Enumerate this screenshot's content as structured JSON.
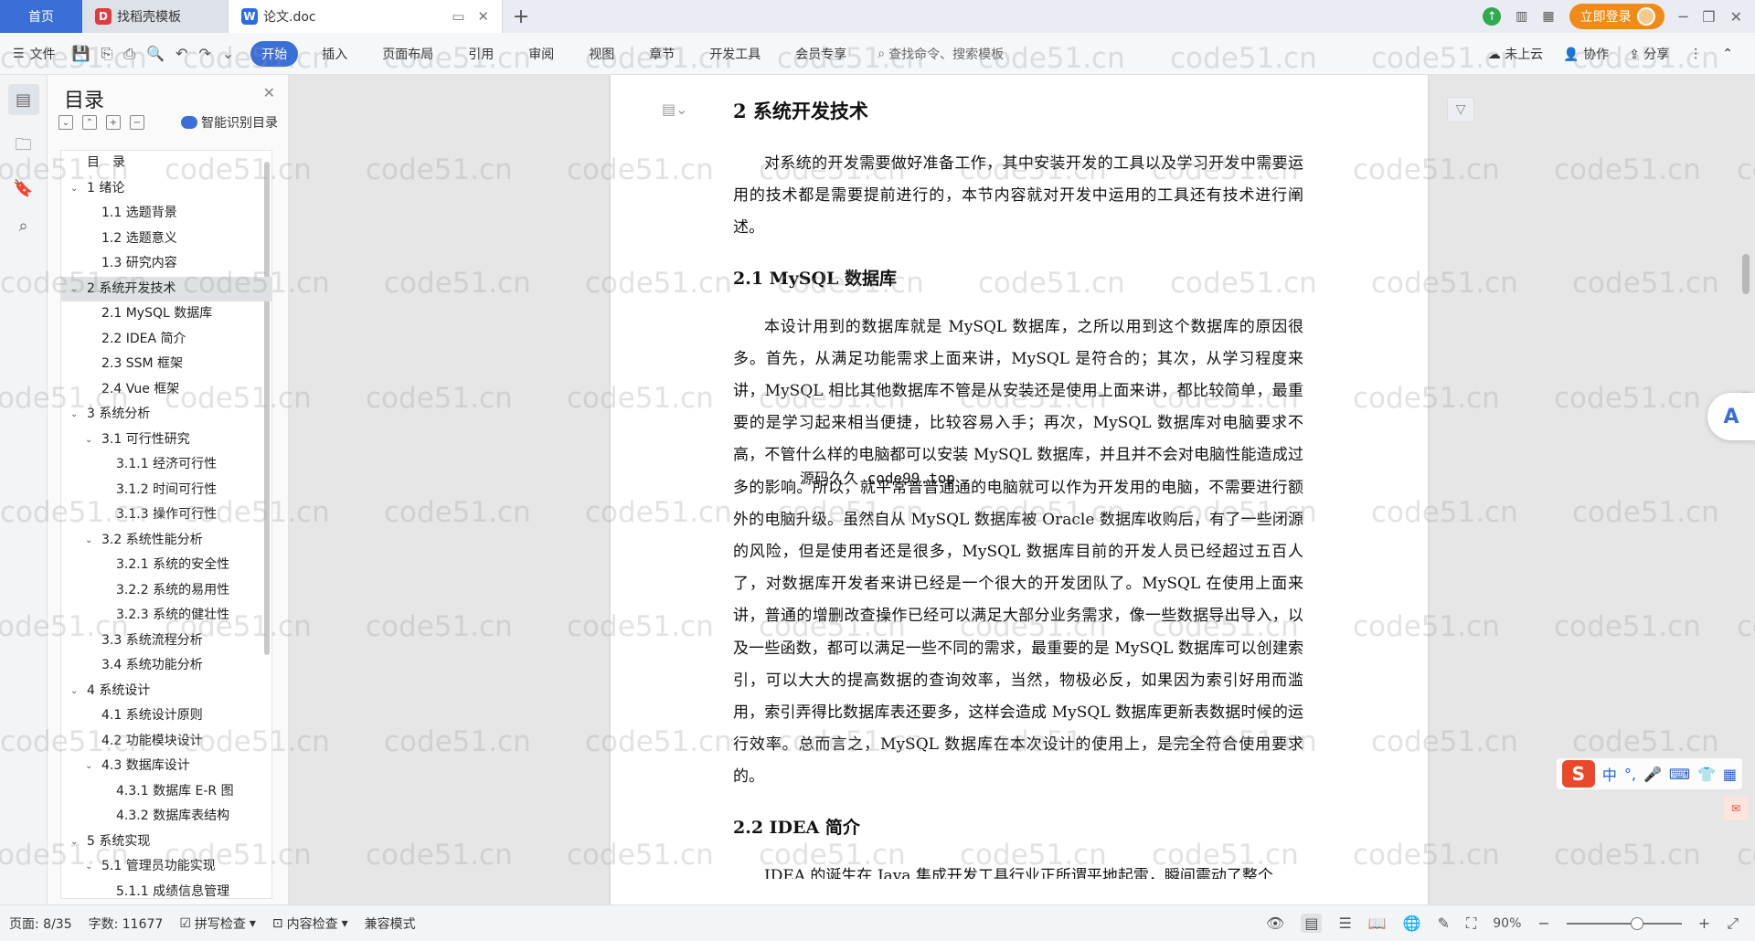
{
  "tabs": {
    "home": "首页",
    "template_tab": "找稻壳模板",
    "doc_tab": "论文.doc",
    "new_tab": "+"
  },
  "titlebar_right": {
    "login": "立即登录"
  },
  "ribbon": {
    "file": "文件",
    "tabs": [
      "开始",
      "插入",
      "页面布局",
      "引用",
      "审阅",
      "视图",
      "章节",
      "开发工具",
      "会员专享"
    ],
    "search": "查找命令、搜索模板",
    "cloud": "未上云",
    "collab": "协作",
    "share": "分享"
  },
  "toc": {
    "title": "目录",
    "smart": "智能识别目录",
    "items": [
      {
        "text": "目　录",
        "level": 1,
        "expand": ""
      },
      {
        "text": "1  绪论",
        "level": 1,
        "expand": "open"
      },
      {
        "text": "1.1  选题背景",
        "level": 2,
        "expand": ""
      },
      {
        "text": "1.2  选题意义",
        "level": 2,
        "expand": ""
      },
      {
        "text": "1.3  研究内容",
        "level": 2,
        "expand": ""
      },
      {
        "text": "2  系统开发技术",
        "level": 1,
        "expand": "open",
        "selected": true
      },
      {
        "text": "2.1 MySQL 数据库",
        "level": 2,
        "expand": ""
      },
      {
        "text": "2.2 IDEA 简介",
        "level": 2,
        "expand": ""
      },
      {
        "text": "2.3 SSM 框架",
        "level": 2,
        "expand": ""
      },
      {
        "text": "2.4 Vue 框架",
        "level": 2,
        "expand": ""
      },
      {
        "text": "3  系统分析",
        "level": 1,
        "expand": "open"
      },
      {
        "text": "3.1  可行性研究",
        "level": 2,
        "expand": "open"
      },
      {
        "text": "3.1.1  经济可行性",
        "level": 3,
        "expand": ""
      },
      {
        "text": "3.1.2  时间可行性",
        "level": 3,
        "expand": ""
      },
      {
        "text": "3.1.3  操作可行性",
        "level": 3,
        "expand": ""
      },
      {
        "text": "3.2  系统性能分析",
        "level": 2,
        "expand": "open"
      },
      {
        "text": "3.2.1  系统的安全性",
        "level": 3,
        "expand": ""
      },
      {
        "text": "3.2.2  系统的易用性",
        "level": 3,
        "expand": ""
      },
      {
        "text": "3.2.3  系统的健壮性",
        "level": 3,
        "expand": ""
      },
      {
        "text": "3.3  系统流程分析",
        "level": 2,
        "expand": ""
      },
      {
        "text": "3.4  系统功能分析",
        "level": 2,
        "expand": ""
      },
      {
        "text": "4  系统设计",
        "level": 1,
        "expand": "open"
      },
      {
        "text": "4.1  系统设计原则",
        "level": 2,
        "expand": ""
      },
      {
        "text": "4.2  功能模块设计",
        "level": 2,
        "expand": ""
      },
      {
        "text": "4.3  数据库设计",
        "level": 2,
        "expand": "open"
      },
      {
        "text": "4.3.1  数据库 E-R 图",
        "level": 3,
        "expand": ""
      },
      {
        "text": "4.3.2  数据库表结构",
        "level": 3,
        "expand": ""
      },
      {
        "text": "5  系统实现",
        "level": 1,
        "expand": "open"
      },
      {
        "text": "5.1  管理员功能实现",
        "level": 2,
        "expand": "open"
      },
      {
        "text": "5.1.1  成绩信息管理",
        "level": 3,
        "expand": ""
      }
    ]
  },
  "document": {
    "h1": "2  系统开发技术",
    "p1": "对系统的开发需要做好准备工作，其中安装开发的工具以及学习开发中需要运用的技术都是需要提前进行的，本节内容就对开发中运用的工具还有技术进行阐述。",
    "h2_1": "2.1 MySQL 数据库",
    "p2": "本设计用到的数据库就是 MySQL 数据库，之所以用到这个数据库的原因很多。首先，从满足功能需求上面来讲，MySQL 是符合的；其次，从学习程度来讲，MySQL 相比其他数据库不管是从安装还是使用上面来讲，都比较简单，最重要的是学习起来相当便捷，比较容易入手；再次，MySQL 数据库对电脑要求不高，不管什么样的电脑都可以安装 MySQL 数据库，并且并不会对电脑性能造成过多的影响。所以，就平常普普通通的电脑就可以作为开发用的电脑，不需要进行额外的电脑升级。虽然自从 MySQL 数据库被 Oracle 数据库收购后，有了一些闭源的风险，但是使用者还是很多，MySQL 数据库目前的开发人员已经超过五百人了，对数据库开发者来讲已经是一个很大的开发团队了。MySQL 在使用上面来讲，普通的增删改查操作已经可以满足大部分业务需求，像一些数据导出导入，以及一些函数，都可以满足一些不同的需求，最重要的是 MySQL 数据库可以创建索引，可以大大的提高数据的查询效率，当然，物极必反，如果因为索引好用而滥用，索引弄得比数据库表还要多，这样会造成 MySQL 数据库更新表数据时候的运行效率。总而言之，MySQL 数据库在本次设计的使用上，是完全符合使用要求的。",
    "h2_2": "2.2 IDEA 简介",
    "p3": "IDEA 的诞生在 Java 集成开发工具行业正所谓平地起雷，瞬间震动了整个"
  },
  "watermark": {
    "text": "code51.cn",
    "center": "源码久久 code99.top"
  },
  "ime": {
    "mode": "中"
  },
  "statusbar": {
    "page": "页面: 8/35",
    "words": "字数: 11677",
    "spell": "拼写检查",
    "content": "内容检查",
    "compat": "兼容模式",
    "zoom": "90%"
  }
}
